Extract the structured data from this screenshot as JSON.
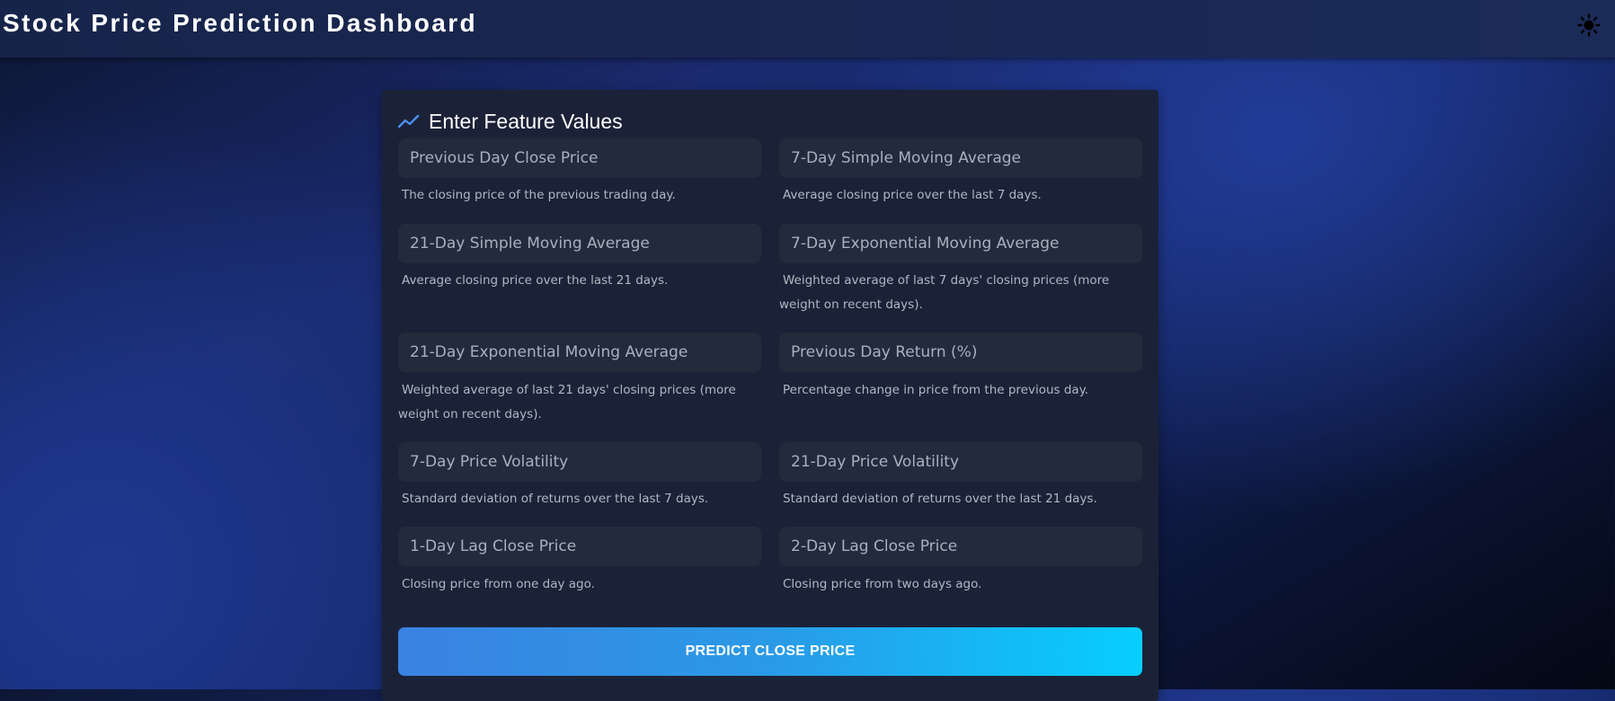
{
  "header": {
    "title": "Stock Price Prediction Dashboard",
    "theme_toggle_icon": "sun-icon"
  },
  "form": {
    "title": "Enter Feature Values",
    "title_icon": "trending-up-icon",
    "fields": [
      {
        "placeholder": "Previous Day Close Price",
        "value": "",
        "help": "The closing price of the previous trading day."
      },
      {
        "placeholder": "7-Day Simple Moving Average",
        "value": "",
        "help": "Average closing price over the last 7 days."
      },
      {
        "placeholder": "21-Day Simple Moving Average",
        "value": "",
        "help": "Average closing price over the last 21 days."
      },
      {
        "placeholder": "7-Day Exponential Moving Average",
        "value": "",
        "help": "Weighted average of last 7 days' closing prices (more weight on recent days)."
      },
      {
        "placeholder": "21-Day Exponential Moving Average",
        "value": "",
        "help": "Weighted average of last 21 days' closing prices (more weight on recent days)."
      },
      {
        "placeholder": "Previous Day Return (%)",
        "value": "",
        "help": "Percentage change in price from the previous day."
      },
      {
        "placeholder": "7-Day Price Volatility",
        "value": "",
        "help": "Standard deviation of returns over the last 7 days."
      },
      {
        "placeholder": "21-Day Price Volatility",
        "value": "",
        "help": "Standard deviation of returns over the last 21 days."
      },
      {
        "placeholder": "1-Day Lag Close Price",
        "value": "",
        "help": "Closing price from one day ago."
      },
      {
        "placeholder": "2-Day Lag Close Price",
        "value": "",
        "help": "Closing price from two days ago."
      }
    ],
    "submit_label": "PREDICT CLOSE PRICE"
  },
  "colors": {
    "accent_start": "#3a82e0",
    "accent_end": "#06ceff",
    "panel": "#1b2237",
    "field": "#222b3c",
    "header": "#1b2b58"
  }
}
